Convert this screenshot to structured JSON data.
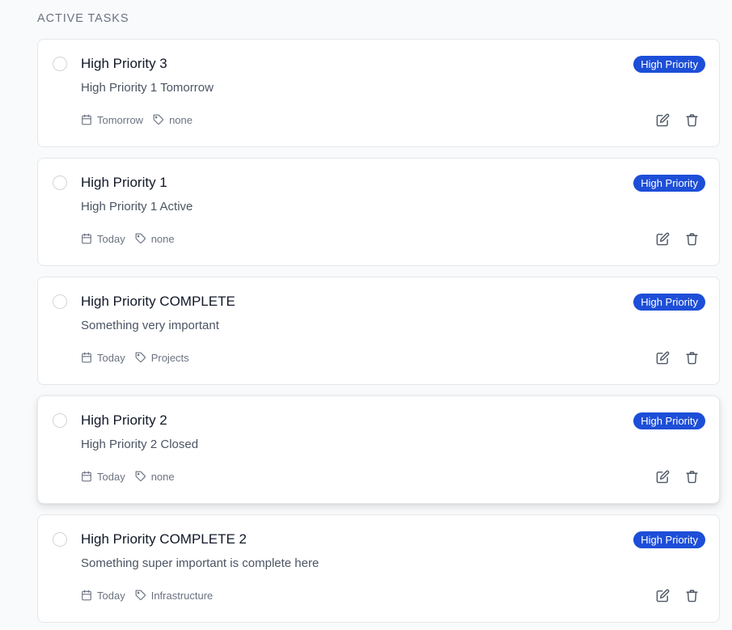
{
  "section": {
    "title": "ACTIVE TASKS"
  },
  "colors": {
    "badge": "#1d4ed8",
    "text": "#111827",
    "muted": "#6b7280"
  },
  "tasks": [
    {
      "title": "High Priority 3",
      "description": "High Priority 1 Tomorrow",
      "priority": "High Priority",
      "due": "Tomorrow",
      "tag": "none"
    },
    {
      "title": "High Priority 1",
      "description": "High Priority 1 Active",
      "priority": "High Priority",
      "due": "Today",
      "tag": "none"
    },
    {
      "title": "High Priority COMPLETE",
      "description": "Something very important",
      "priority": "High Priority",
      "due": "Today",
      "tag": "Projects"
    },
    {
      "title": "High Priority 2",
      "description": "High Priority 2 Closed",
      "priority": "High Priority",
      "due": "Today",
      "tag": "none"
    },
    {
      "title": "High Priority COMPLETE 2",
      "description": "Something super important is complete here",
      "priority": "High Priority",
      "due": "Today",
      "tag": "Infrastructure"
    }
  ],
  "icons": {
    "checkbox": "circle-checkbox-icon",
    "due": "calendar-icon",
    "tag": "tag-icon",
    "edit": "edit-icon",
    "delete": "trash-icon"
  }
}
